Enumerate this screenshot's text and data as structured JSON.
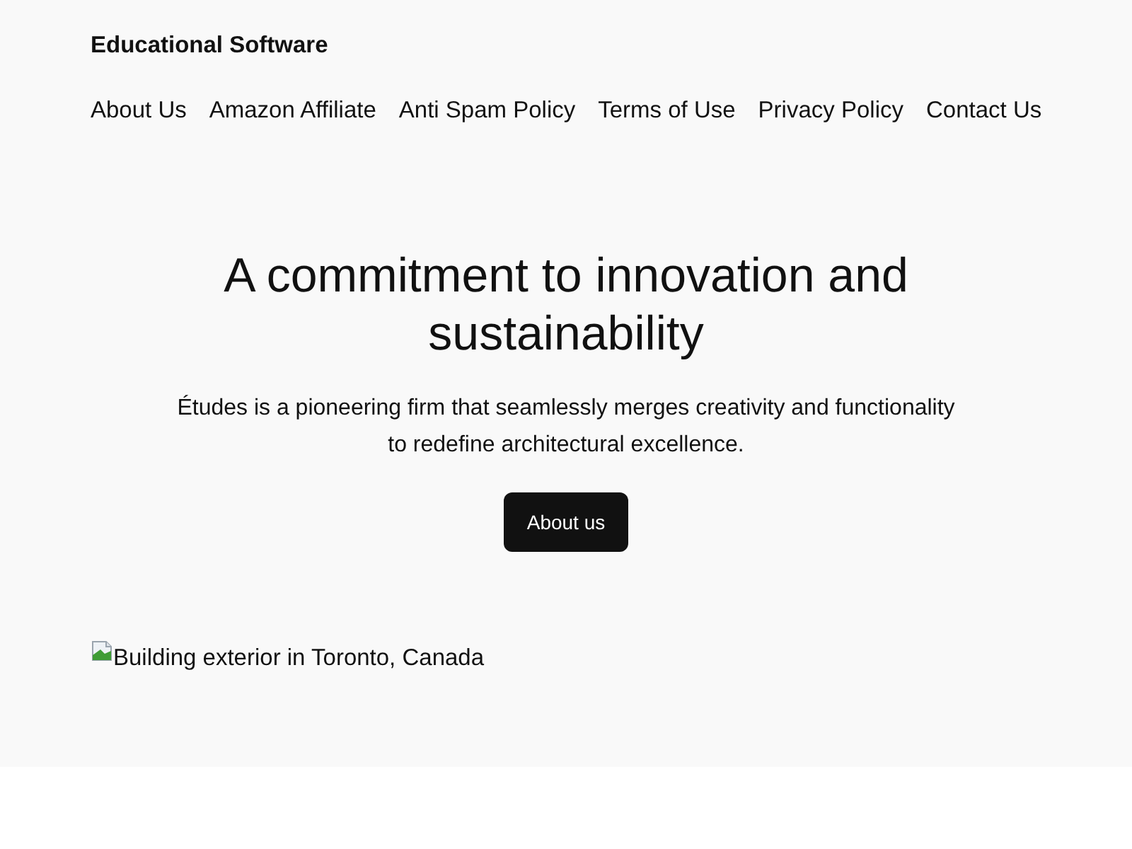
{
  "site_title": "Educational Software",
  "nav": [
    "About Us",
    "Amazon Affiliate",
    "Anti Spam Policy",
    "Terms of Use",
    "Privacy Policy",
    "Contact Us"
  ],
  "hero": {
    "heading": "A commitment to innovation and sustainability",
    "text": "Études is a pioneering firm that seamlessly merges creativity and functionality to redefine architectural excellence.",
    "button": "About us"
  },
  "image": {
    "alt": "Building exterior in Toronto, Canada"
  }
}
